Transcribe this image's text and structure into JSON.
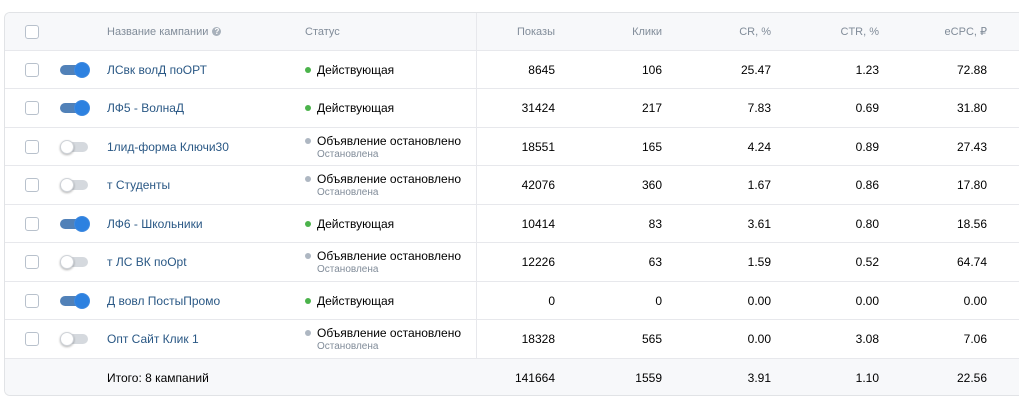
{
  "header": {
    "name": "Название кампании",
    "status": "Статус",
    "impressions": "Показы",
    "clicks": "Клики",
    "cr": "CR, %",
    "ctr": "CTR, %",
    "ecpc": "eCPC, ₽",
    "help_icon_glyph": "?"
  },
  "colors": {
    "active_dot": "#4bb34b",
    "stopped_dot": "#aeb7c2",
    "link": "#2a5885",
    "toggle_on": "#2d81e0"
  },
  "rows": [
    {
      "name": "ЛСвк волД поОРТ",
      "enabled": true,
      "status": "Действующая",
      "status_sub": "",
      "active": true,
      "impressions": "8645",
      "clicks": "106",
      "cr": "25.47",
      "ctr": "1.23",
      "ecpc": "72.88"
    },
    {
      "name": "ЛФ5 - ВолнаД",
      "enabled": true,
      "status": "Действующая",
      "status_sub": "",
      "active": true,
      "impressions": "31424",
      "clicks": "217",
      "cr": "7.83",
      "ctr": "0.69",
      "ecpc": "31.80"
    },
    {
      "name": "1лид-форма Ключи30",
      "enabled": false,
      "status": "Объявление остановлено",
      "status_sub": "Остановлена",
      "active": false,
      "impressions": "18551",
      "clicks": "165",
      "cr": "4.24",
      "ctr": "0.89",
      "ecpc": "27.43"
    },
    {
      "name": "т Студенты",
      "enabled": false,
      "status": "Объявление остановлено",
      "status_sub": "Остановлена",
      "active": false,
      "impressions": "42076",
      "clicks": "360",
      "cr": "1.67",
      "ctr": "0.86",
      "ecpc": "17.80"
    },
    {
      "name": "ЛФ6 - Школьники",
      "enabled": true,
      "status": "Действующая",
      "status_sub": "",
      "active": true,
      "impressions": "10414",
      "clicks": "83",
      "cr": "3.61",
      "ctr": "0.80",
      "ecpc": "18.56"
    },
    {
      "name": "т ЛС ВК поOpt",
      "enabled": false,
      "status": "Объявление остановлено",
      "status_sub": "Остановлена",
      "active": false,
      "impressions": "12226",
      "clicks": "63",
      "cr": "1.59",
      "ctr": "0.52",
      "ecpc": "64.74"
    },
    {
      "name": "Д вовл ПостыПромо",
      "enabled": true,
      "status": "Действующая",
      "status_sub": "",
      "active": true,
      "impressions": "0",
      "clicks": "0",
      "cr": "0.00",
      "ctr": "0.00",
      "ecpc": "0.00"
    },
    {
      "name": "Опт Сайт Клик 1",
      "enabled": false,
      "status": "Объявление остановлено",
      "status_sub": "Остановлена",
      "active": false,
      "impressions": "18328",
      "clicks": "565",
      "cr": "0.00",
      "ctr": "3.08",
      "ecpc": "7.06"
    }
  ],
  "footer": {
    "label": "Итого: 8 кампаний",
    "impressions": "141664",
    "clicks": "1559",
    "cr": "3.91",
    "ctr": "1.10",
    "ecpc": "22.56"
  }
}
